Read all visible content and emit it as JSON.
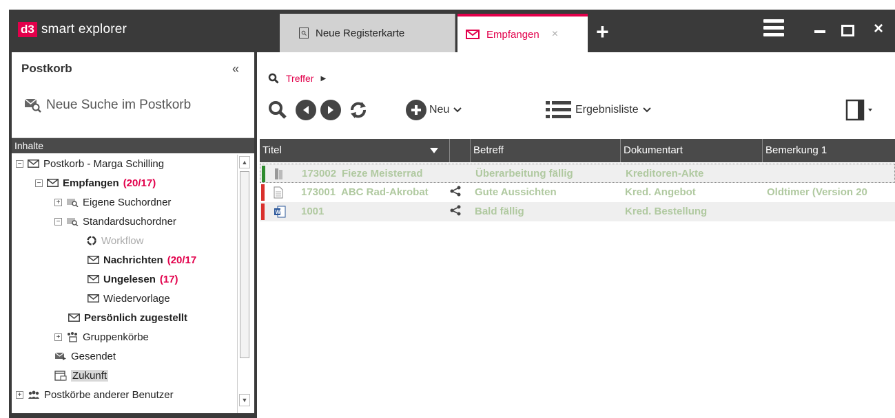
{
  "app": {
    "logo_mark": "d3",
    "logo_text": "smart explorer"
  },
  "tabs": [
    {
      "label": "Neue Registerkarte"
    },
    {
      "label": "Empfangen",
      "close": "×"
    }
  ],
  "tab_add": "+",
  "window": {
    "close": "×"
  },
  "left": {
    "title": "Postkorb",
    "collapse": "«",
    "new_search": "Neue Suche im Postkorb",
    "section": "Inhalte",
    "tree": [
      {
        "label": "Postkorb - Marga Schilling"
      },
      {
        "label": "Empfangen",
        "count": "(20/17)"
      },
      {
        "label": "Eigene Suchordner"
      },
      {
        "label": "Standardsuchordner"
      },
      {
        "label": "Workflow"
      },
      {
        "label": "Nachrichten",
        "count": "(20/17"
      },
      {
        "label": "Ungelesen",
        "count": "(17)"
      },
      {
        "label": "Wiedervorlage"
      },
      {
        "label": "Persönlich zugestellt"
      },
      {
        "label": "Gruppenkörbe"
      },
      {
        "label": "Gesendet"
      },
      {
        "label": "Zukunft"
      },
      {
        "label": "Postkörbe anderer Benutzer"
      }
    ]
  },
  "right": {
    "breadcrumb": "Treffer",
    "toolbar": {
      "new_label": "Neu",
      "results_label": "Ergebnisliste"
    },
    "columns": [
      "Titel",
      "Betreff",
      "Dokumentart",
      "Bemerkung 1"
    ],
    "rows": [
      {
        "id": "173002",
        "title": "Fieze Meisterrad",
        "betreff": "Überarbeitung fällig",
        "doc": "Kreditoren-Akte",
        "note": "",
        "status": "#2e8b2e",
        "icon": "folder"
      },
      {
        "id": "173001",
        "title": "ABC Rad-Akrobat",
        "betreff": "Gute Aussichten",
        "doc": "Kred. Angebot",
        "note": "Oldtimer (Version 20",
        "status": "#d9302c",
        "icon": "page"
      },
      {
        "id": "1001",
        "title": "",
        "betreff": "Bald fällig",
        "doc": "Kred. Bestellung",
        "note": "",
        "status": "#d9302c",
        "icon": "word"
      }
    ]
  },
  "colors": {
    "accent": "#e2004b",
    "dark": "#3a3a3a"
  }
}
